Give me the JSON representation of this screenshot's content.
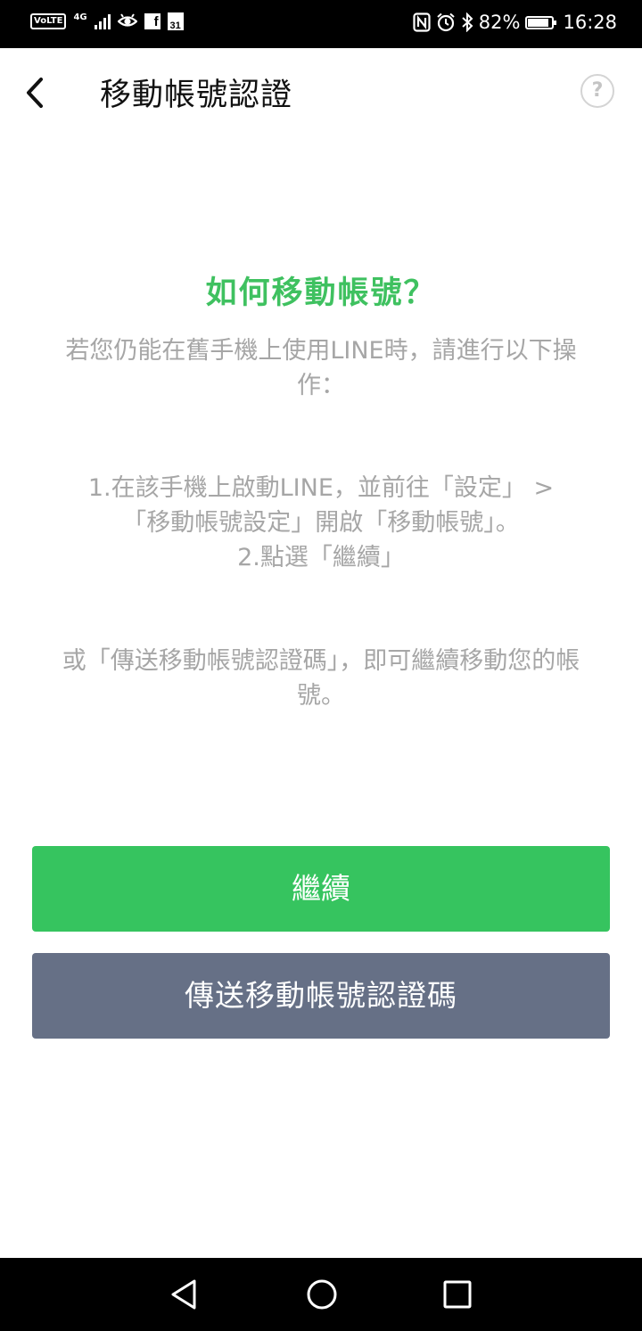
{
  "status_bar": {
    "volte": "VoLTE",
    "network": "4G",
    "facebook_glyph": "f",
    "calendar_day": "31",
    "battery": "82%",
    "time": "16:28"
  },
  "header": {
    "title": "移動帳號認證",
    "help_glyph": "?"
  },
  "content": {
    "heading": "如何移動帳號？",
    "intro": "若您仍能在舊手機上使用LINE時，請進行以下操作：",
    "steps": [
      "1.在該手機上啟動LINE，並前往「設定」 >",
      "「移動帳號設定」開啟「移動帳號」。",
      "2.點選「繼續」"
    ],
    "alternative": "或「傳送移動帳號認證碼」，即可繼續移動您的帳號。"
  },
  "buttons": {
    "continue": "繼續",
    "send_code": "傳送移動帳號認證碼"
  },
  "colors": {
    "accent_green": "#36c45f",
    "heading_green": "#3fc160",
    "secondary_button": "#667086",
    "body_text": "#a6a6a6"
  },
  "icons": {
    "back": "chevron-left-icon",
    "help": "question-circle-icon",
    "nav_back": "triangle-back-icon",
    "nav_home": "circle-home-icon",
    "nav_recent": "square-recent-icon"
  }
}
